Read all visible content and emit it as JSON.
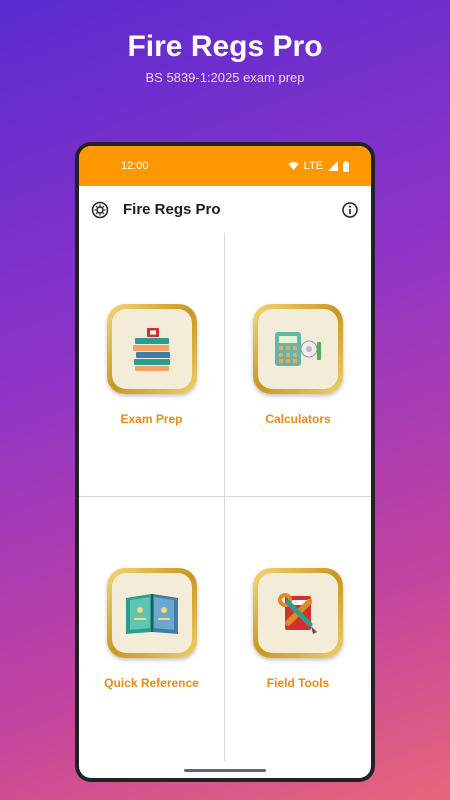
{
  "promo": {
    "title": "Fire Regs Pro",
    "subtitle": "BS 5839-1:2025 exam prep"
  },
  "statusbar": {
    "time": "12:00",
    "network": "LTE",
    "icons": [
      "wifi-icon",
      "signal-icon",
      "battery-icon"
    ]
  },
  "appbar": {
    "title": "Fire Regs Pro",
    "left_icon": "settings-icon",
    "right_icon": "info-icon"
  },
  "menu": [
    {
      "label": "Exam Prep",
      "icon": "books-icon"
    },
    {
      "label": "Calculators",
      "icon": "calculator-icon"
    },
    {
      "label": "Quick Reference",
      "icon": "open-book-icon"
    },
    {
      "label": "Field Tools",
      "icon": "tools-icon"
    }
  ],
  "colors": {
    "accent": "#ff9800",
    "label": "#f08a0a",
    "gold": "#c9961e"
  }
}
